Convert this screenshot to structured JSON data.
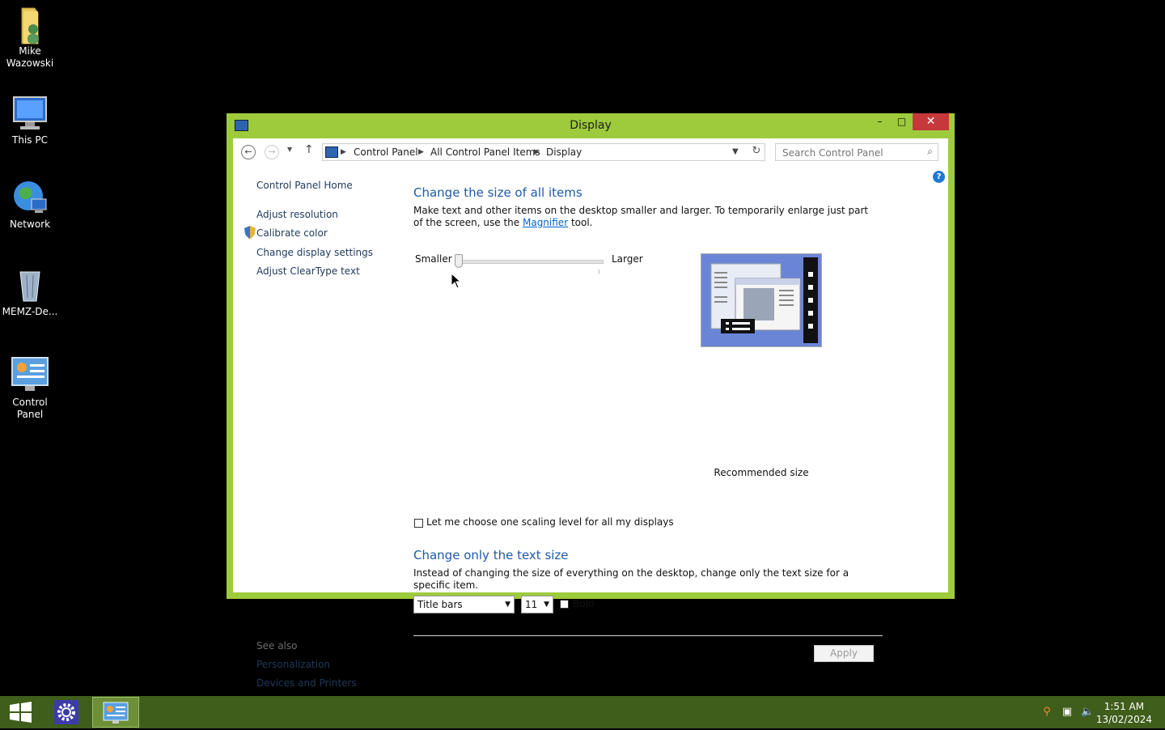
{
  "desktop": {
    "icons": [
      {
        "label": "Mike\nWazowski",
        "line1": "Mike",
        "line2": "Wazowski"
      },
      {
        "label": "This PC"
      },
      {
        "label": "Network"
      },
      {
        "label": "MEMZ-De..."
      },
      {
        "label": "Control\nPanel",
        "line1": "Control",
        "line2": "Panel"
      }
    ]
  },
  "window": {
    "title": "Display",
    "close_glyph": "✕",
    "max_glyph": "□",
    "min_glyph": "–",
    "breadcrumb": [
      "Control Panel",
      "All Control Panel Items",
      "Display"
    ],
    "search_placeholder": "Search Control Panel",
    "help_glyph": "?"
  },
  "sidebar": {
    "home": "Control Panel Home",
    "links": [
      "Adjust resolution",
      "Calibrate color",
      "Change display settings",
      "Adjust ClearType text"
    ],
    "see_also_title": "See also",
    "see_also": [
      "Personalization",
      "Devices and Printers"
    ]
  },
  "main": {
    "section1_heading": "Change the size of all items",
    "section1_text_before": "Make text and other items on the desktop smaller and larger. To temporarily enlarge just part of the screen, use the ",
    "section1_link": "Magnifier",
    "section1_text_after": " tool.",
    "slider_min_label": "Smaller",
    "slider_max_label": "Larger",
    "slider_value": 0,
    "preview_caption": "Recommended size",
    "scaling_checkbox_label": "Let me choose one scaling level for all my displays",
    "scaling_checkbox_checked": false,
    "section2_heading": "Change only the text size",
    "section2_text": "Instead of changing the size of everything on the desktop, change only the text size for a specific item.",
    "item_select_value": "Title bars",
    "size_select_value": "11",
    "bold_label": "Bold",
    "bold_checked": false,
    "apply_label": "Apply"
  },
  "taskbar": {
    "time": "1:51 AM",
    "date": "13/02/2024"
  },
  "colors": {
    "window_frame": "#9dcb3c",
    "taskbar": "#3f5d1b",
    "close_button": "#c7383a",
    "heading": "#1e5aa8",
    "link": "#1e395b"
  }
}
